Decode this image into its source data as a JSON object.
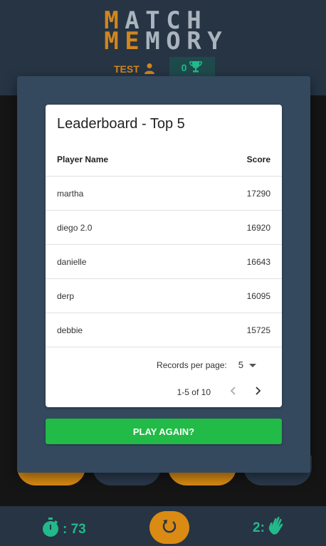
{
  "header": {
    "logo_line1": [
      "M",
      "A",
      "T",
      "C",
      "H"
    ],
    "logo_line2": [
      "M",
      "E",
      "M",
      "O",
      "R",
      "Y"
    ],
    "logo_colors_line1": [
      "#d1861e",
      "#aab4be",
      "#aab4be",
      "#aab4be",
      "#aab4be"
    ],
    "logo_colors_line2": [
      "#d1861e",
      "#d1861e",
      "#aab4be",
      "#aab4be",
      "#aab4be",
      "#aab4be"
    ],
    "username": "TEST",
    "user_icon": "person-icon",
    "trophies": "0",
    "trophy_icon": "trophy-icon"
  },
  "leaderboard": {
    "title": "Leaderboard - Top 5",
    "columns": {
      "player": "Player Name",
      "score": "Score"
    },
    "rows": [
      {
        "player": "martha",
        "score": "17290"
      },
      {
        "player": "diego 2.0",
        "score": "16920"
      },
      {
        "player": "danielle",
        "score": "16643"
      },
      {
        "player": "derp",
        "score": "16095"
      },
      {
        "player": "debbie",
        "score": "15725"
      }
    ],
    "records_per_page_label": "Records per page:",
    "records_per_page_value": "5",
    "range_text": "1-5 of 10"
  },
  "modal": {
    "play_again": "PLAY AGAIN?"
  },
  "footer": {
    "timer": ": 73",
    "timer_icon": "stopwatch-icon",
    "reset_icon": "reset-icon",
    "pairs": "2:",
    "pairs_icon": "hand-icon"
  },
  "colors": {
    "accent_orange": "#d98b13",
    "accent_green": "#23b98a",
    "button_green": "#22bb47",
    "panel": "#34495e",
    "header_bg": "#263444"
  }
}
